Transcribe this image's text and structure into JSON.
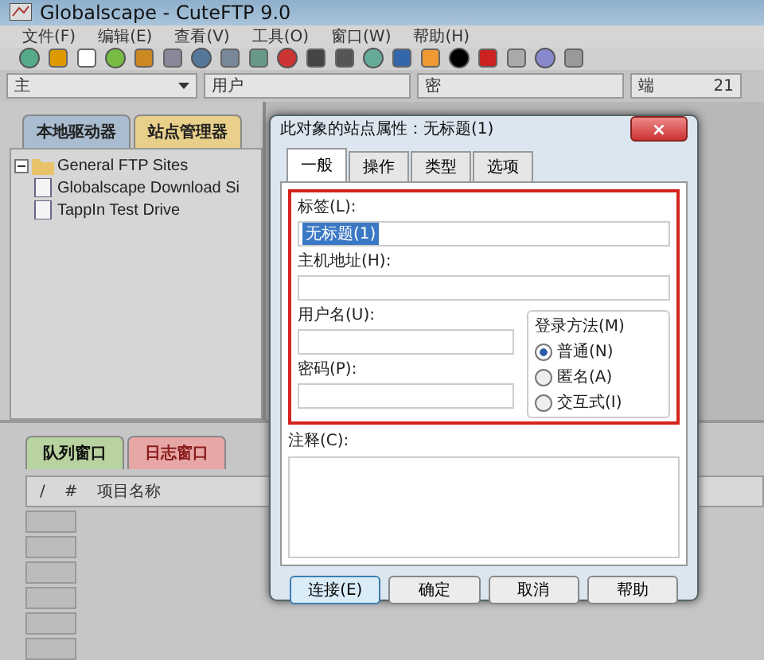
{
  "window": {
    "title": "Globalscape - CuteFTP 9.0"
  },
  "menu": [
    "文件(F)",
    "编辑(E)",
    "查看(V)",
    "工具(O)",
    "窗口(W)",
    "帮助(H)"
  ],
  "quick_connect": [
    {
      "label": "主",
      "kind": "dropdown"
    },
    {
      "label": "用户",
      "kind": "field"
    },
    {
      "label": "密",
      "kind": "field"
    },
    {
      "label": "端",
      "value": "21",
      "kind": "port"
    }
  ],
  "left_tabs": [
    {
      "label": "本地驱动器",
      "selected": false
    },
    {
      "label": "站点管理器",
      "selected": true
    }
  ],
  "site_tree": [
    {
      "label": "General FTP Sites",
      "expanded": true,
      "children": [
        {
          "label": "Globalscape Download Si"
        },
        {
          "label": "TappIn Test Drive"
        }
      ]
    }
  ],
  "bottom_tabs": [
    {
      "label": "队列窗口",
      "selected": true,
      "color": "#b9d3a0"
    },
    {
      "label": "日志窗口",
      "selected": false,
      "color": "#e8a7a7"
    }
  ],
  "queue_columns": [
    "/",
    "#",
    "项目名称"
  ],
  "dialog": {
    "title": "此对象的站点属性：无标题(1)",
    "close": "×",
    "tabs": [
      {
        "label": "一般",
        "selected": true
      },
      {
        "label": "操作",
        "selected": false
      },
      {
        "label": "类型",
        "selected": false
      },
      {
        "label": "选项",
        "selected": false
      }
    ],
    "label_field": {
      "label": "标签(L):",
      "value": "无标题(1)"
    },
    "host_field": {
      "label": "主机地址(H):"
    },
    "user_field": {
      "label": "用户名(U):"
    },
    "password_field": {
      "label": "密码(P):"
    },
    "login_method": {
      "title": "登录方法(M)",
      "options": [
        {
          "label": "普通(N)",
          "selected": true
        },
        {
          "label": "匿名(A)",
          "selected": false
        },
        {
          "label": "交互式(I)",
          "selected": false
        }
      ]
    },
    "comment_field": {
      "label": "注释(C):"
    },
    "buttons": [
      {
        "label": "连接(E)",
        "default": true
      },
      {
        "label": "确定",
        "default": false
      },
      {
        "label": "取消",
        "default": false
      },
      {
        "label": "帮助",
        "default": false
      }
    ]
  }
}
